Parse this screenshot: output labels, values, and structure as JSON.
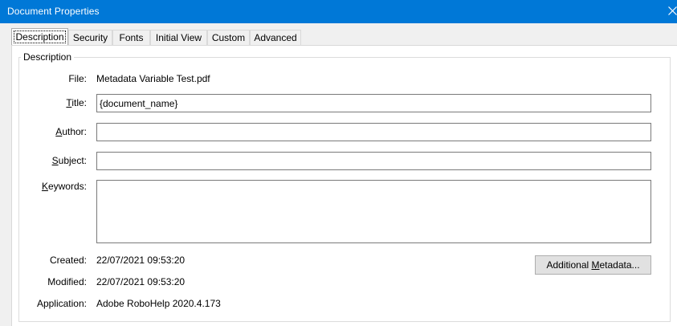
{
  "window": {
    "title": "Document Properties"
  },
  "tabs": [
    {
      "label": "Description",
      "active": true
    },
    {
      "label": "Security"
    },
    {
      "label": "Fonts"
    },
    {
      "label": "Initial View"
    },
    {
      "label": "Custom"
    },
    {
      "label": "Advanced"
    }
  ],
  "description": {
    "group_title": "Description",
    "file_label": "File:",
    "file_value": "Metadata Variable Test.pdf",
    "title_label_key": "T",
    "title_label_rest": "itle:",
    "title_value": "{document_name}",
    "author_label_key": "A",
    "author_label_rest": "uthor:",
    "author_value": "",
    "subject_label_key": "S",
    "subject_label_rest": "ubject:",
    "subject_value": "",
    "keywords_label_key": "K",
    "keywords_label_rest": "eywords:",
    "keywords_value": "",
    "created_label": "Created:",
    "created_value": "22/07/2021 09:53:20",
    "modified_label": "Modified:",
    "modified_value": "22/07/2021 09:53:20",
    "application_label": "Application:",
    "application_value": "Adobe RoboHelp 2020.4.173",
    "additional_button_pre": "Additional ",
    "additional_button_key": "M",
    "additional_button_post": "etadata..."
  },
  "icons": {
    "close": "close-icon"
  }
}
